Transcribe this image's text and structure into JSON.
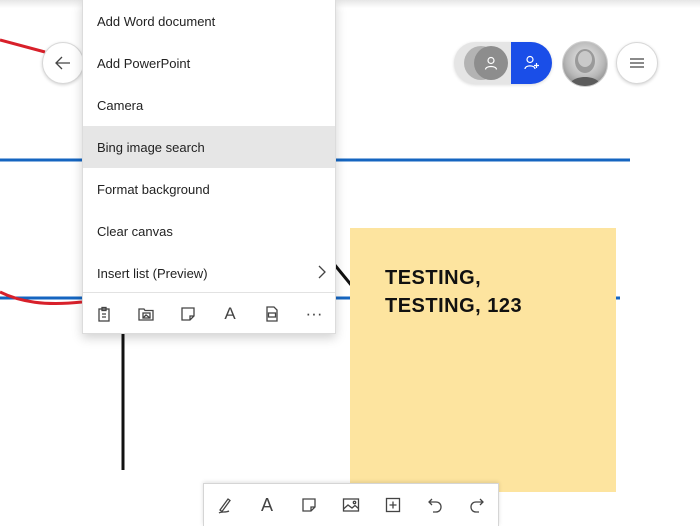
{
  "menu": {
    "items": [
      {
        "label": "Add Word document"
      },
      {
        "label": "Add PowerPoint"
      },
      {
        "label": "Camera"
      },
      {
        "label": "Bing image search",
        "highlighted": true
      },
      {
        "label": "Format background"
      },
      {
        "label": "Clear canvas"
      },
      {
        "label": "Insert list (Preview)",
        "has_submenu": true
      }
    ],
    "icon_bar": {
      "icons": [
        "clipboard-icon",
        "folder-image-icon",
        "sticky-note-icon",
        "text-icon",
        "pdf-icon",
        "more-icon"
      ],
      "text_glyph": "A",
      "more_glyph": "···"
    }
  },
  "sticky_note": {
    "text": "TESTING,\nTESTING, 123",
    "color": "#fde49f"
  },
  "header": {
    "icons": [
      "back-arrow-icon",
      "person-icon",
      "add-person-icon",
      "user-avatar",
      "hamburger-icon"
    ],
    "accent_color": "#1a4ee8"
  },
  "toolbar": {
    "icons": [
      "pen-icon",
      "text-icon",
      "sticky-note-icon",
      "image-icon",
      "add-box-icon",
      "undo-icon",
      "redo-icon"
    ],
    "text_glyph": "A"
  },
  "ink_colors": {
    "blue": "#1565c0",
    "red": "#d8202a",
    "black": "#111111"
  }
}
